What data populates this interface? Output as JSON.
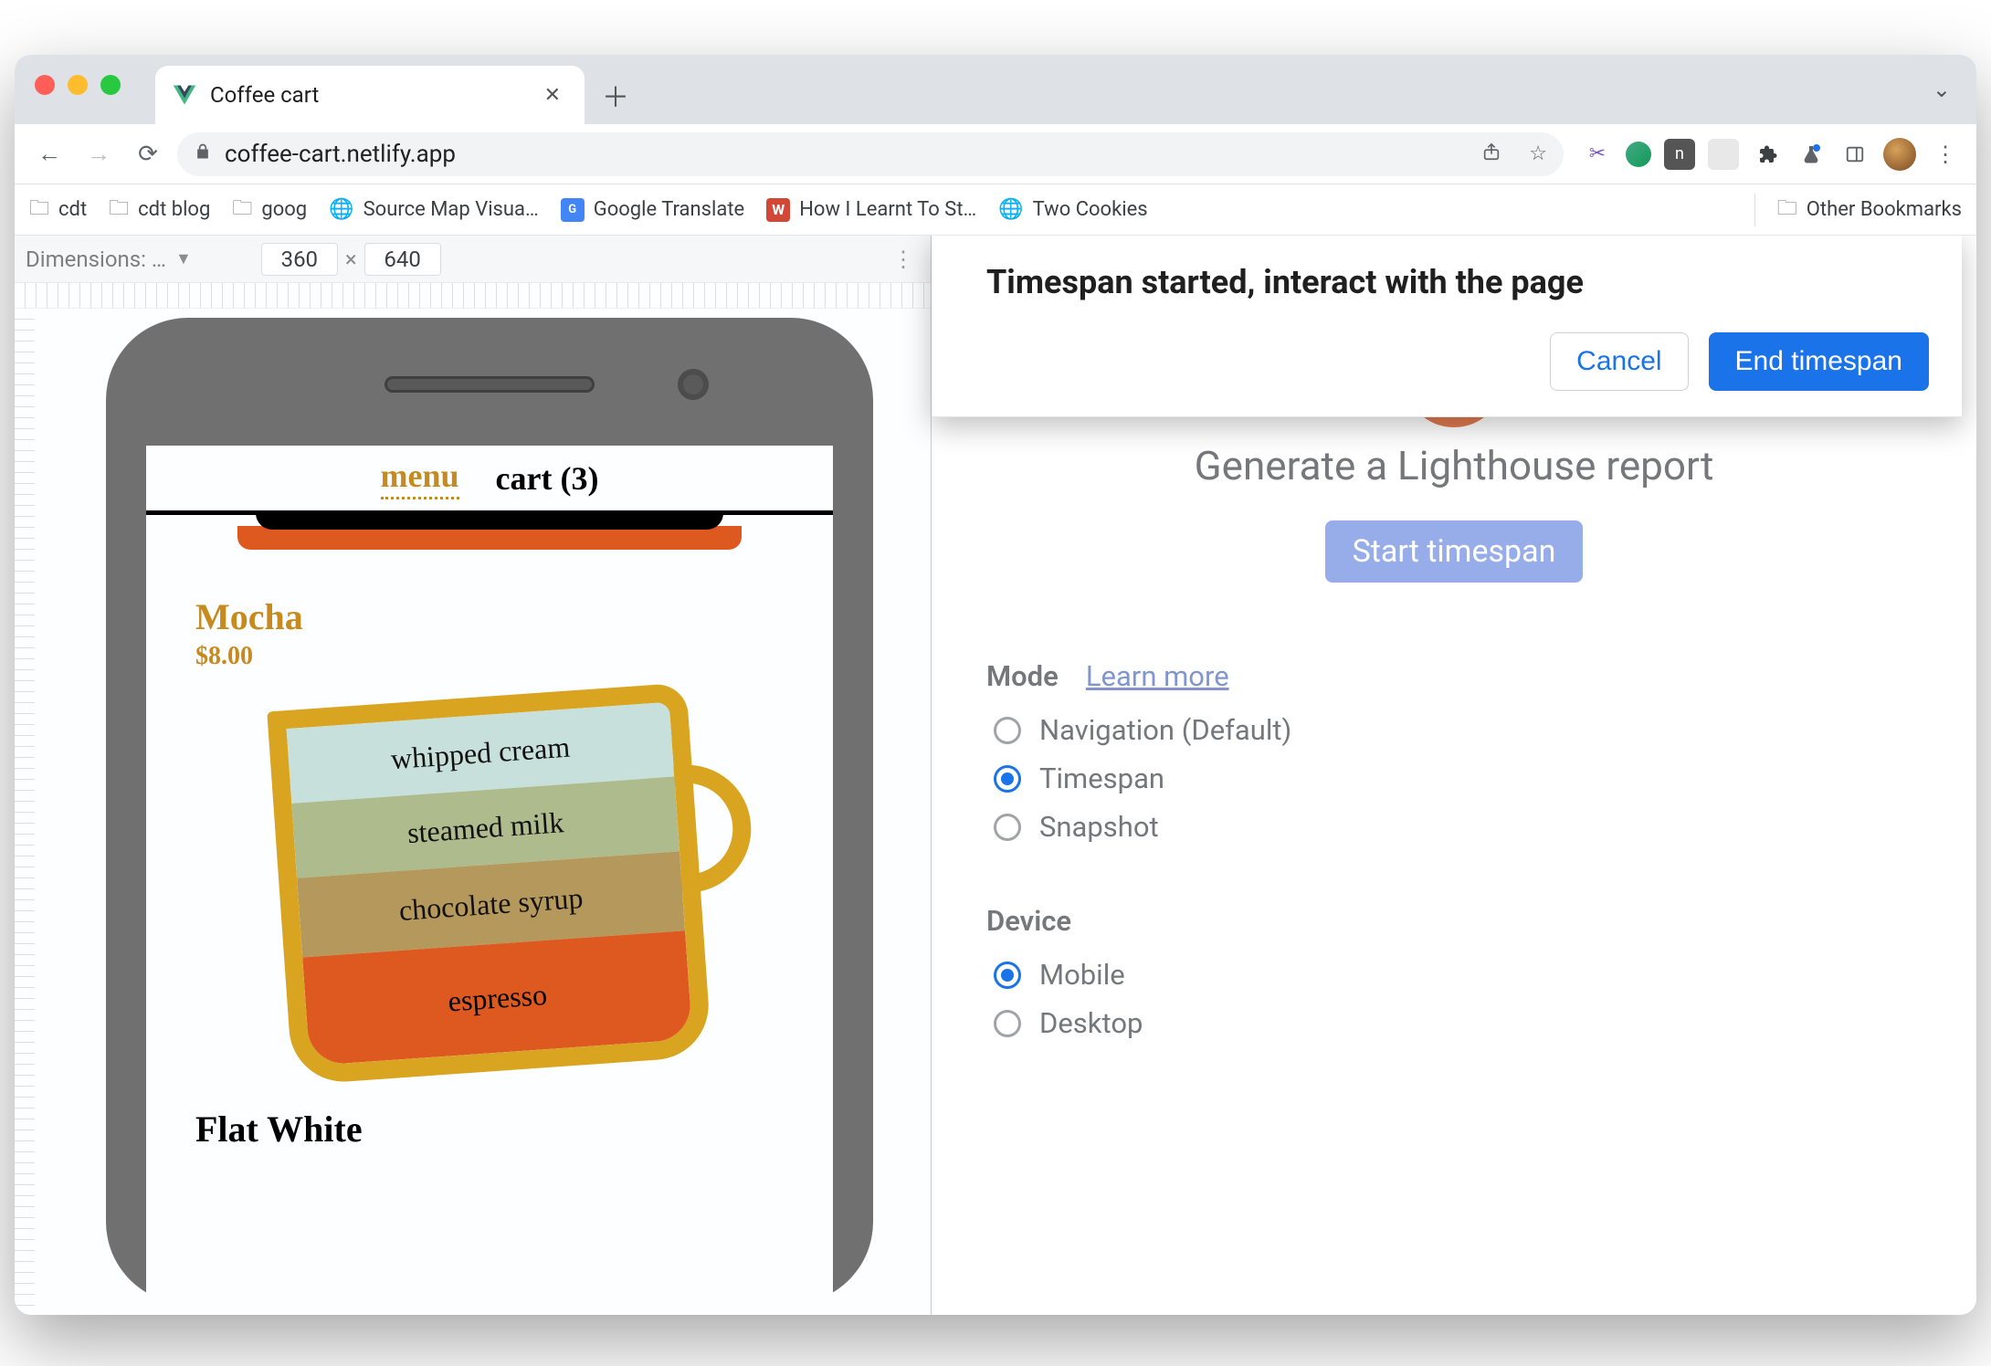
{
  "tab": {
    "title": "Coffee cart"
  },
  "address": {
    "url": "coffee-cart.netlify.app"
  },
  "bookmarks": {
    "items": [
      "cdt",
      "cdt blog",
      "goog",
      "Source Map Visua…",
      "Google Translate",
      "How I Learnt To St…",
      "Two Cookies"
    ],
    "other": "Other Bookmarks"
  },
  "device_toolbar": {
    "label": "Dimensions: …",
    "width": "360",
    "height": "640"
  },
  "app": {
    "nav": {
      "menu": "menu",
      "cart": "cart (3)"
    },
    "product1": {
      "name": "Mocha",
      "price": "$8.00",
      "layers": [
        "whipped cream",
        "steamed milk",
        "chocolate syrup",
        "espresso"
      ]
    },
    "product2": {
      "name": "Flat White"
    }
  },
  "lighthouse": {
    "heading": "Generate a Lighthouse report",
    "start": "Start timespan",
    "mode": {
      "label": "Mode",
      "learn_more": "Learn more",
      "options": [
        "Navigation (Default)",
        "Timespan",
        "Snapshot"
      ],
      "selected": "Timespan"
    },
    "device": {
      "label": "Device",
      "options": [
        "Mobile",
        "Desktop"
      ],
      "selected": "Mobile"
    }
  },
  "modal": {
    "message": "Timespan started, interact with the page",
    "cancel": "Cancel",
    "end": "End timespan"
  }
}
